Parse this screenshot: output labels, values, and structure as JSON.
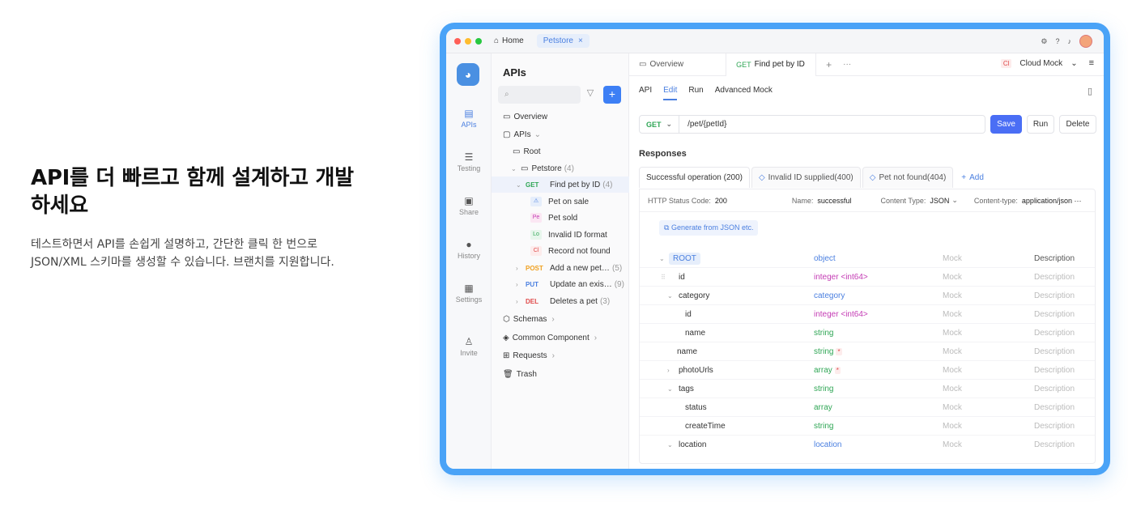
{
  "hero": {
    "title": "API를 더 빠르고 함께 설계하고 개발하세요",
    "description": "테스트하면서 API를 손쉽게 설명하고, 간단한 클릭 한 번으로 JSON/XML 스키마를 생성할 수 있습니다. 브랜치를 지원합니다."
  },
  "titlebar": {
    "home": "Home",
    "tab": "Petstore",
    "tab_close": "×"
  },
  "rail": {
    "items": [
      "APIs",
      "Testing",
      "Share",
      "History",
      "Settings",
      "Invite"
    ]
  },
  "tree": {
    "title": "APIs",
    "search_placeholder": "",
    "items": [
      {
        "label": "Overview"
      },
      {
        "label": "APIs"
      },
      {
        "label": "Root"
      },
      {
        "label": "Petstore",
        "count": "(4)"
      },
      {
        "method": "GET",
        "label": "Find pet by ID",
        "count": "(4)"
      },
      {
        "badge": "⚠",
        "label": "Pet on sale"
      },
      {
        "badge": "Pe",
        "label": "Pet sold"
      },
      {
        "badge": "Lo",
        "label": "Invalid ID format"
      },
      {
        "badge": "Cl",
        "label": "Record not found"
      },
      {
        "method": "POST",
        "label": "Add a new pet…",
        "count": "(5)"
      },
      {
        "method": "PUT",
        "label": "Update an exis…",
        "count": "(9)"
      },
      {
        "method": "DEL",
        "label": "Deletes a pet",
        "count": "(3)"
      },
      {
        "label": "Schemas"
      },
      {
        "label": "Common Component"
      },
      {
        "label": "Requests"
      },
      {
        "label": "Trash"
      }
    ]
  },
  "main": {
    "tabs": [
      "Overview",
      "GET",
      "Find pet by ID"
    ],
    "cloud_mock_badge": "Cl",
    "cloud_mock": "Cloud Mock",
    "subtabs": [
      "API",
      "Edit",
      "Run",
      "Advanced Mock"
    ],
    "method": "GET",
    "path": "/pet/{petId}",
    "buttons": {
      "save": "Save",
      "run": "Run",
      "delete": "Delete"
    },
    "responses_title": "Responses",
    "response_tabs": [
      "Successful operation (200)",
      "Invalid ID supplied(400)",
      "Pet not found(404)",
      "Add"
    ],
    "meta": {
      "status_label": "HTTP Status Code:",
      "status": "200",
      "name_label": "Name:",
      "name": "successful",
      "ctype_label": "Content Type:",
      "ctype": "JSON",
      "ctype2_label": "Content-type:",
      "ctype2": "application/json ···"
    },
    "generate": "Generate from JSON etc.",
    "schema": [
      {
        "name": "ROOT",
        "type": "object",
        "mock": "Mock",
        "desc": "Description"
      },
      {
        "name": "id",
        "type": "integer <int64>",
        "mock": "Mock",
        "desc": "Description"
      },
      {
        "name": "category",
        "type": "category",
        "mock": "Mock",
        "desc": "Description"
      },
      {
        "name": "id",
        "type": "integer <int64>",
        "mock": "Mock",
        "desc": "Description"
      },
      {
        "name": "name",
        "type": "string",
        "mock": "Mock",
        "desc": "Description"
      },
      {
        "name": "name",
        "type": "string",
        "mock": "Mock",
        "desc": "Description"
      },
      {
        "name": "photoUrls",
        "type": "array",
        "mock": "Mock",
        "desc": "Description"
      },
      {
        "name": "tags",
        "type": "string",
        "mock": "Mock",
        "desc": "Description"
      },
      {
        "name": "status",
        "type": "array",
        "mock": "Mock",
        "desc": "Description"
      },
      {
        "name": "createTime",
        "type": "string",
        "mock": "Mock",
        "desc": "Description"
      },
      {
        "name": "location",
        "type": "location",
        "mock": "Mock",
        "desc": "Description"
      }
    ]
  },
  "colors": {
    "accent": "#4a7fe0",
    "frame": "#4aa3f7",
    "save": "#4a6ef5"
  }
}
